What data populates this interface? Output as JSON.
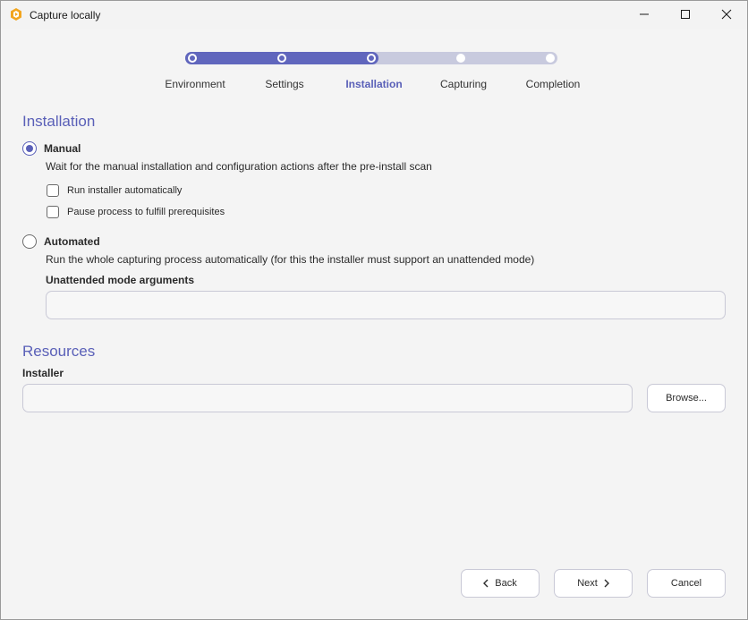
{
  "window": {
    "title": "Capture locally",
    "icon": "app-logo-icon",
    "accent_color": "#5a60b8"
  },
  "stepper": {
    "steps": [
      {
        "label": "Environment",
        "state": "done"
      },
      {
        "label": "Settings",
        "state": "done"
      },
      {
        "label": "Installation",
        "state": "active"
      },
      {
        "label": "Capturing",
        "state": "todo"
      },
      {
        "label": "Completion",
        "state": "todo"
      }
    ]
  },
  "installation": {
    "heading": "Installation",
    "manual": {
      "label": "Manual",
      "selected": true,
      "description": "Wait for the manual installation and configuration actions after the pre-install scan",
      "options": [
        {
          "label": "Run installer automatically",
          "checked": false
        },
        {
          "label": "Pause process to fulfill prerequisites",
          "checked": false
        }
      ]
    },
    "automated": {
      "label": "Automated",
      "selected": false,
      "description": "Run the whole capturing process automatically (for this the installer must support an unattended mode)",
      "arguments_label": "Unattended mode arguments",
      "arguments_value": ""
    }
  },
  "resources": {
    "heading": "Resources",
    "installer_label": "Installer",
    "installer_value": "",
    "browse_label": "Browse..."
  },
  "footer": {
    "back_label": "Back",
    "next_label": "Next",
    "cancel_label": "Cancel"
  }
}
